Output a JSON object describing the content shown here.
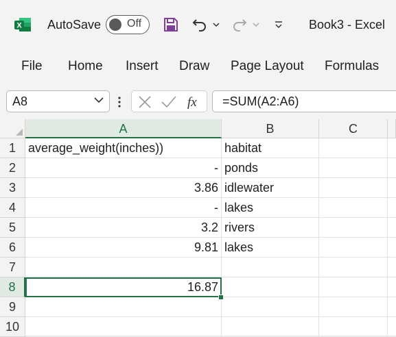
{
  "titlebar": {
    "autosave_label": "AutoSave",
    "toggle_state": "Off",
    "doc_title": "Book3  -  Excel",
    "icons": [
      "excel-logo",
      "save-icon",
      "undo-icon",
      "redo-icon",
      "customize-quick-access-icon"
    ]
  },
  "ribbon": {
    "tabs": [
      "File",
      "Home",
      "Insert",
      "Draw",
      "Page Layout",
      "Formulas"
    ]
  },
  "formula_bar": {
    "name_box": "A8",
    "formula": "=SUM(A2:A6)"
  },
  "columns": [
    "A",
    "B",
    "C"
  ],
  "rows": [
    {
      "n": "1",
      "a": "average_weight(inches))",
      "b": "habitat"
    },
    {
      "n": "2",
      "a": "-",
      "b": "ponds"
    },
    {
      "n": "3",
      "a": "3.86",
      "b": "idlewater"
    },
    {
      "n": "4",
      "a": "-",
      "b": "lakes"
    },
    {
      "n": "5",
      "a": "3.2",
      "b": "rivers"
    },
    {
      "n": "6",
      "a": "9.81",
      "b": "lakes"
    },
    {
      "n": "7",
      "a": "",
      "b": ""
    },
    {
      "n": "8",
      "a": "16.87",
      "b": ""
    },
    {
      "n": "9",
      "a": "",
      "b": ""
    },
    {
      "n": "10",
      "a": "",
      "b": ""
    }
  ],
  "colors": {
    "accent": "#217346",
    "excel_green": "#107c41",
    "save_purple": "#7e3f98"
  }
}
